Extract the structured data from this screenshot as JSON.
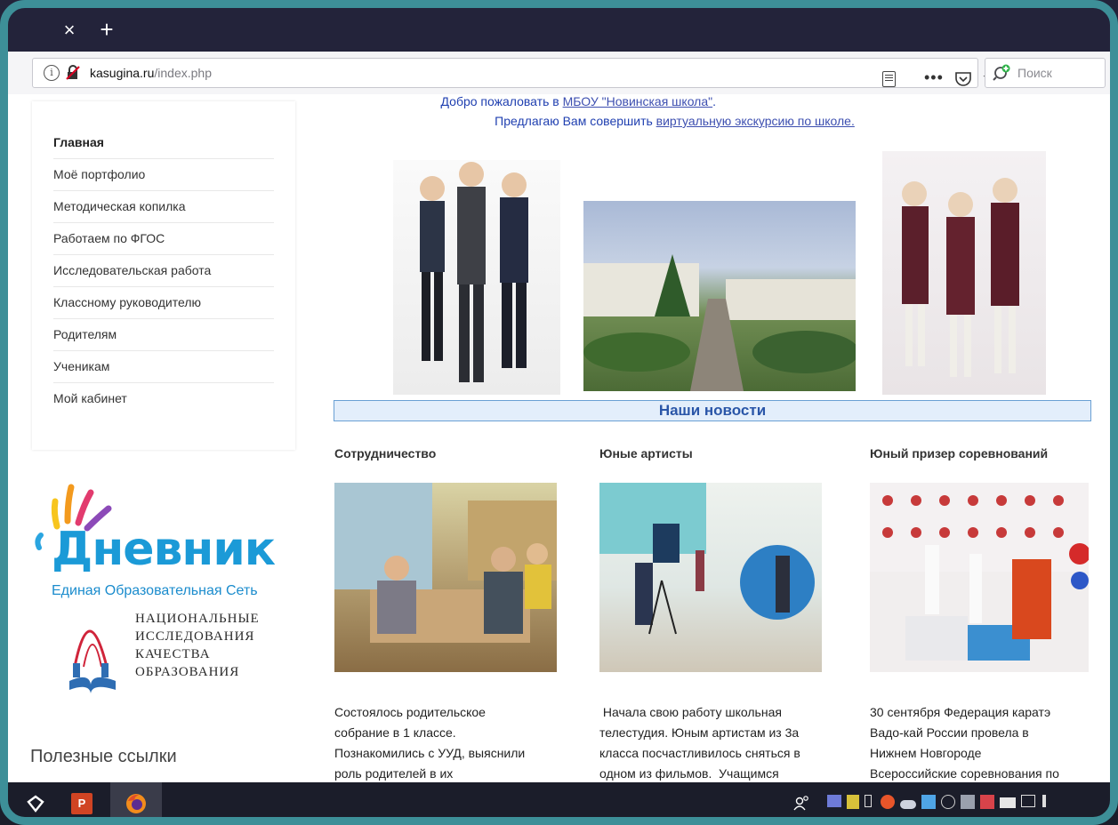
{
  "browser": {
    "tab_close_glyph": "×",
    "new_tab_glyph": "+",
    "url_host": "kasugina.ru",
    "url_path": "/index.php",
    "more_glyph": "•••",
    "star_glyph": "☆",
    "search_placeholder": "Поиск"
  },
  "header": {
    "welcome_prefix": "Добро пожаловать в ",
    "welcome_link": "МБОУ \"Новинская школа\"",
    "welcome_suffix": ".",
    "tour_prefix": "Предлагаю Вам совершить ",
    "tour_link": "виртуальную экскурсию по школе."
  },
  "sidebar": {
    "items": [
      {
        "label": "Главная",
        "active": true
      },
      {
        "label": "Моё портфолио"
      },
      {
        "label": "Методическая копилка"
      },
      {
        "label": "Работаем по ФГОС"
      },
      {
        "label": "Исследовательская работа"
      },
      {
        "label": "Классному руководителю"
      },
      {
        "label": "Родителям"
      },
      {
        "label": "Ученикам"
      },
      {
        "label": "Мой кабинет"
      }
    ],
    "dnevnik_logo_word": "Дневник",
    "dnevnik_logo_sub": "Единая Образовательная Сеть",
    "nik_logo_lines": [
      "НАЦИОНАЛЬНЫЕ",
      "ИССЛЕДОВАНИЯ",
      "КАЧЕСТВА",
      "ОБРАЗОВАНИЯ"
    ],
    "useful_links_heading": "Полезные ссылки"
  },
  "news": {
    "heading": "Наши новости",
    "items": [
      {
        "title": "Сотрудничество",
        "lines": [
          "Состоялось родительское",
          "собрание в 1 классе.",
          "Познакомились с УУД, выяснили",
          "роль родителей в их"
        ]
      },
      {
        "title": "Юные артисты",
        "lines": [
          " Начала свою работу школьная",
          "телестудия. Юным артистам из 3а",
          "класса посчастливилось сняться в",
          "одном из фильмов.  Учащимся"
        ]
      },
      {
        "title": "Юный призер соревнований",
        "lines": [
          "30 сентября Федерация каратэ",
          "Вадо-кай России провела в",
          "Нижнем Новгороде",
          "Всероссийские соревнования по"
        ]
      }
    ]
  },
  "colors": {
    "tabbar": "#23233a",
    "frame": "#3d8f98",
    "link": "#3d4fb0",
    "welcome_text": "#1f3fb0",
    "news_heading": "#2a56a8"
  },
  "taskbar": {
    "icons": [
      "start-icon",
      "powerpoint-icon",
      "firefox-icon",
      "people-icon"
    ]
  }
}
